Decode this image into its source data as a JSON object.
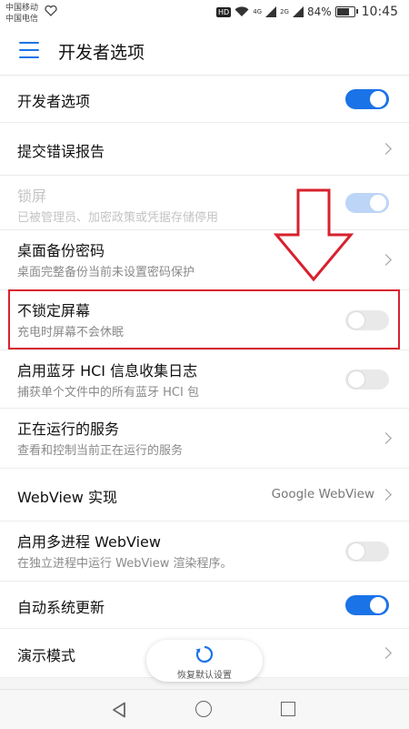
{
  "status_bar": {
    "carrier_1": "中国移动",
    "carrier_2": "中国电信",
    "hd_badge": "HD",
    "net_1": "4G",
    "net_2": "2G",
    "battery_percent": "84%",
    "battery_level": 0.84,
    "time": "10:45"
  },
  "app_bar": {
    "title": "开发者选项"
  },
  "settings": [
    {
      "title": "开发者选项",
      "type": "toggle",
      "state": "on"
    },
    {
      "title": "提交错误报告",
      "type": "chevron"
    },
    {
      "title": "锁屏",
      "subtitle": "已被管理员、加密政策或凭据存储停用",
      "type": "toggle",
      "state": "on",
      "disabled": true
    },
    {
      "title": "桌面备份密码",
      "subtitle": "桌面完整备份当前未设置密码保护",
      "type": "chevron"
    },
    {
      "title": "不锁定屏幕",
      "subtitle": "充电时屏幕不会休眠",
      "type": "toggle",
      "state": "off"
    },
    {
      "title": "启用蓝牙 HCI 信息收集日志",
      "subtitle": "捕获单个文件中的所有蓝牙 HCI 包",
      "type": "toggle",
      "state": "off"
    },
    {
      "title": "正在运行的服务",
      "subtitle": "查看和控制当前正在运行的服务",
      "type": "chevron"
    },
    {
      "title": "WebView 实现",
      "value": "Google WebView",
      "type": "chevron"
    },
    {
      "title": "启用多进程 WebView",
      "subtitle": "在独立进程中运行 WebView 渲染程序。",
      "type": "toggle",
      "state": "off"
    },
    {
      "title": "自动系统更新",
      "type": "toggle",
      "state": "on"
    },
    {
      "title": "演示模式",
      "type": "chevron"
    }
  ],
  "restore_button": {
    "label": "恢复默认设置",
    "icon": "refresh-icon"
  },
  "annotation": {
    "highlight_color": "#d8212e",
    "arrow_icon": "down-arrow-icon"
  },
  "nav_bar": {
    "back_icon": "back-triangle-icon",
    "home_icon": "home-circle-icon",
    "recent_icon": "recent-square-icon"
  },
  "colors": {
    "accent": "#1b73e8",
    "toggle_off": "#e9e9e9",
    "disabled_text": "#c4c4c4"
  }
}
